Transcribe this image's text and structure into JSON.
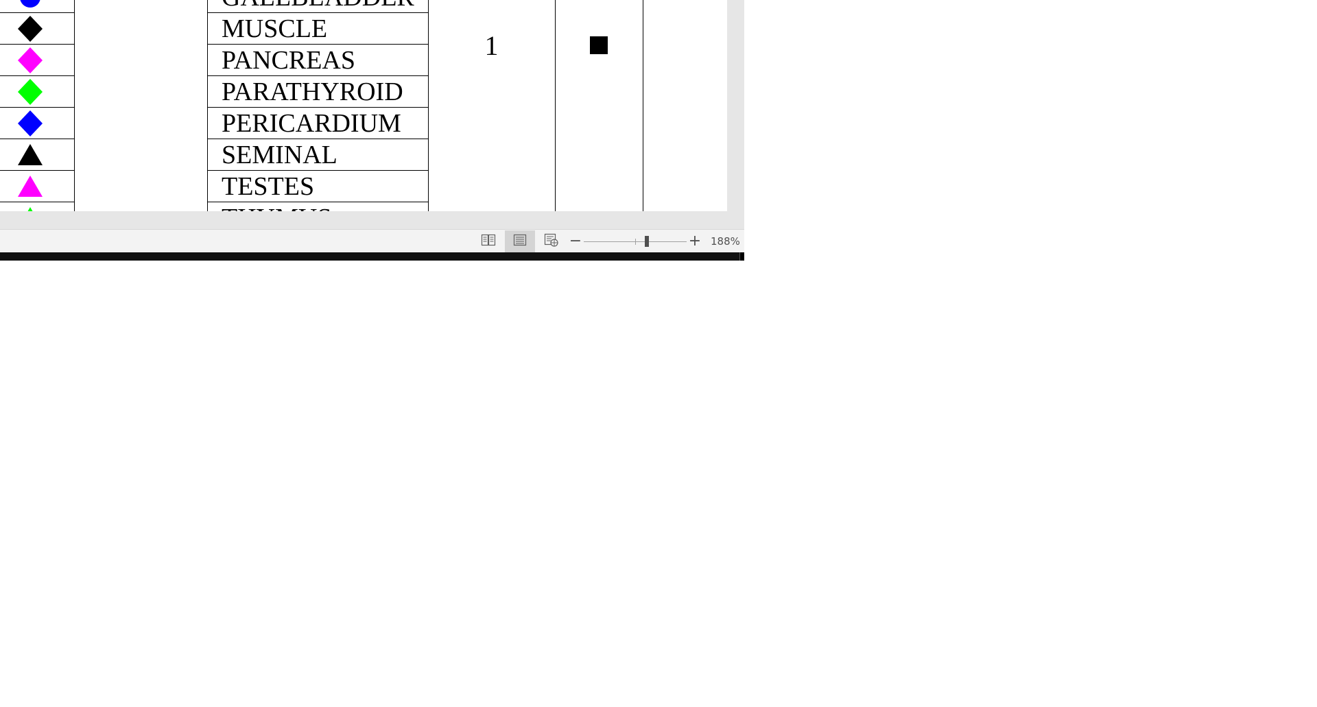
{
  "document": {
    "table": {
      "rows": [
        {
          "label": "GALLBLADDER",
          "marker": "circle-icon",
          "color": "#0000ff"
        },
        {
          "label": "MUSCLE",
          "marker": "diamond-icon",
          "color": "#000000"
        },
        {
          "label": "PANCREAS",
          "marker": "diamond-icon",
          "color": "#ff00ff"
        },
        {
          "label": "PARATHYROID",
          "marker": "diamond-icon",
          "color": "#00ff00"
        },
        {
          "label": "PERICARDIUM",
          "marker": "diamond-icon",
          "color": "#0000ff"
        },
        {
          "label": "SEMINAL",
          "marker": "triangle-icon",
          "color": "#000000"
        },
        {
          "label": "TESTES",
          "marker": "triangle-icon",
          "color": "#ff00ff"
        },
        {
          "label": "THYMUS",
          "marker": "triangle-icon",
          "color": "#00ff00"
        }
      ],
      "count_value": "1",
      "group_marker": "square-icon",
      "group_marker_color": "#000000"
    }
  },
  "statusbar": {
    "read_mode_icon": "read-mode-icon",
    "print_layout_icon": "print-layout-icon",
    "web_layout_icon": "web-layout-icon",
    "active_view": "print-layout",
    "zoom_out": "−",
    "zoom_in": "+",
    "zoom_label": "188%",
    "zoom_percent": 188
  }
}
